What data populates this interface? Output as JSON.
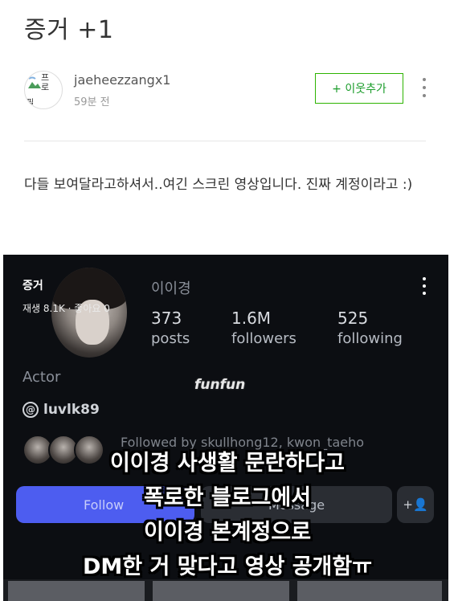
{
  "post": {
    "title": "증거 +1",
    "author": {
      "name": "jaeheezzangx1",
      "time": "59분 전",
      "avatar_text_top": "프로",
      "avatar_text_bottom": "필"
    },
    "follow_button_label": "+ 이웃추가",
    "body": "다들 보여달라고하셔서..여긴 스크린 영상입니다. 진짜 계정이라고 :)"
  },
  "embedded_screenshot": {
    "tag": "증거",
    "stats_line": "재생 8.1K · 좋아요 0",
    "username": "이이경",
    "stats": [
      {
        "value": "373",
        "label": "posts"
      },
      {
        "value": "1.6M",
        "label": "followers"
      },
      {
        "value": "525",
        "label": "following"
      }
    ],
    "bio": "Actor",
    "threads_handle": "luvlk89",
    "followed_by": "Followed by skullhong12, kwon_taeho",
    "follow_label": "Follow",
    "message_label": "Message",
    "add_user_icon": "+user-icon",
    "watermark": "funfun"
  },
  "caption_lines": [
    "이이경 사생활 문란하다고",
    "폭로한 블로그에서",
    "이이경 본계정으로",
    "DM한 거 맞다고 영상 공개함ㅠ"
  ],
  "colors": {
    "follow_green": "#2db400",
    "instagram_blue": "#4d5df0",
    "screenshot_bg": "#0c0e12"
  }
}
